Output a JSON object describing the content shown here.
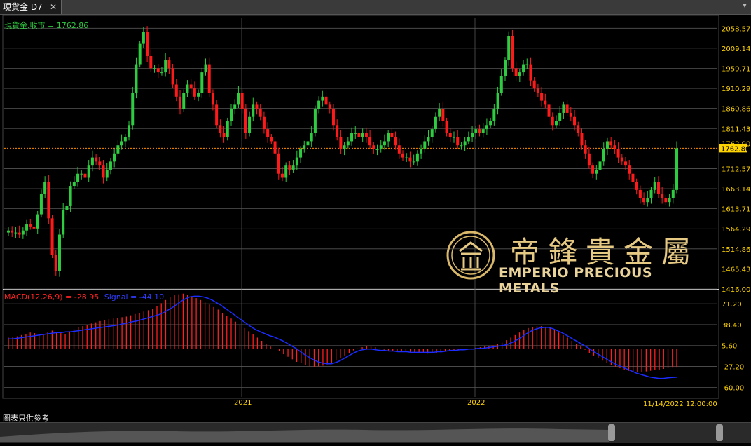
{
  "window": {
    "tab_title": "現貨金 D7",
    "close_glyph": "✕",
    "menu_glyph": "▾"
  },
  "footer": {
    "note": "圖表只供參考"
  },
  "watermark": {
    "cn": "帝鋒貴金屬",
    "en": "EMPERIO PRECIOUS METALS"
  },
  "colors": {
    "up": "#2ecc40",
    "down": "#ff1a1a",
    "grid": "#555555",
    "axis_text": "#ffd400",
    "macd_hist": "#ff2020",
    "signal": "#1a2cff",
    "last_line": "#ff8c00"
  },
  "chart_data": [
    {
      "type": "candlestick",
      "legend": "現貨金.收市 = 1762.86",
      "last_price": 1762.86,
      "last_label": "1762.86",
      "overlay_label": "1762.90",
      "y_ticks": [
        2058.57,
        2009.14,
        1959.71,
        1910.29,
        1860.86,
        1811.43,
        1762.0,
        1712.57,
        1663.14,
        1613.71,
        1564.29,
        1514.86,
        1465.43,
        1416.0
      ],
      "y_tick_labels": [
        "2058.57",
        "2009.14",
        "1959.71",
        "1910.29",
        "1860.86",
        "1811.43",
        "1712.57",
        "1663.14",
        "1613.71",
        "1564.29",
        "1514.86",
        "1465.43",
        "1416.00"
      ],
      "ylim": [
        1416.0,
        2083.29
      ],
      "closes": [
        1560,
        1555,
        1555,
        1550,
        1560,
        1575,
        1570,
        1565,
        1600,
        1650,
        1680,
        1590,
        1500,
        1460,
        1550,
        1610,
        1620,
        1670,
        1680,
        1700,
        1700,
        1690,
        1720,
        1740,
        1730,
        1720,
        1690,
        1710,
        1730,
        1750,
        1770,
        1780,
        1790,
        1820,
        1900,
        1970,
        2020,
        2050,
        1990,
        1960,
        1960,
        1950,
        1950,
        1980,
        1960,
        1920,
        1890,
        1860,
        1900,
        1920,
        1910,
        1890,
        1900,
        1950,
        1970,
        1900,
        1870,
        1820,
        1800,
        1790,
        1830,
        1860,
        1870,
        1900,
        1860,
        1800,
        1840,
        1870,
        1860,
        1840,
        1810,
        1790,
        1780,
        1750,
        1700,
        1690,
        1720,
        1710,
        1720,
        1740,
        1760,
        1770,
        1780,
        1800,
        1860,
        1880,
        1890,
        1870,
        1860,
        1820,
        1790,
        1760,
        1770,
        1780,
        1800,
        1800,
        1790,
        1800,
        1790,
        1770,
        1760,
        1760,
        1770,
        1780,
        1800,
        1790,
        1770,
        1750,
        1740,
        1740,
        1730,
        1730,
        1750,
        1760,
        1780,
        1790,
        1810,
        1840,
        1860,
        1830,
        1800,
        1790,
        1790,
        1770,
        1770,
        1780,
        1790,
        1800,
        1810,
        1800,
        1810,
        1820,
        1830,
        1860,
        1900,
        1940,
        1980,
        2040,
        1960,
        1940,
        1950,
        1970,
        1970,
        1930,
        1910,
        1900,
        1880,
        1870,
        1840,
        1820,
        1830,
        1850,
        1870,
        1850,
        1840,
        1820,
        1800,
        1770,
        1750,
        1720,
        1700,
        1710,
        1730,
        1760,
        1780,
        1770,
        1760,
        1740,
        1730,
        1720,
        1700,
        1680,
        1660,
        1640,
        1630,
        1640,
        1660,
        1680,
        1650,
        1640,
        1630,
        1640,
        1660,
        1762.86
      ],
      "x_tick_labels": [
        "2021",
        "2022",
        "11/14/2022 12:00:00"
      ]
    },
    {
      "type": "bar",
      "legend_macd": "MACD(12,26,9) = -28.95",
      "legend_signal": "Signal = -44.10",
      "y_tick_labels": [
        "71.20",
        "38.40",
        "5.60",
        "-27.20",
        "-60.00"
      ],
      "y_ticks": [
        71.2,
        38.4,
        5.6,
        -27.2,
        -60.0
      ],
      "ylim": [
        -75.0,
        90.0
      ],
      "macd": [
        18,
        19,
        20,
        22,
        24,
        26,
        25,
        24,
        24,
        26,
        29,
        27,
        25,
        24,
        28,
        31,
        34,
        36,
        38,
        40,
        42,
        44,
        46,
        47,
        48,
        49,
        50,
        51,
        53,
        55,
        57,
        59,
        61,
        63,
        67,
        72,
        77,
        82,
        85,
        86,
        87,
        85,
        83,
        80,
        77,
        73,
        70,
        66,
        62,
        57,
        52,
        48,
        43,
        38,
        33,
        28,
        23,
        18,
        13,
        8,
        4,
        1,
        -3,
        -8,
        -12,
        -16,
        -20,
        -22,
        -25,
        -27,
        -28,
        -27,
        -26,
        -24,
        -21,
        -18,
        -14,
        -10,
        -6,
        -2,
        1,
        3,
        5,
        4,
        3,
        1,
        -1,
        -2,
        -3,
        -3,
        -4,
        -4,
        -5,
        -5,
        -6,
        -6,
        -7,
        -6,
        -6,
        -5,
        -4,
        -3,
        -2,
        -1,
        0,
        0,
        1,
        2,
        3,
        4,
        5,
        6,
        8,
        10,
        14,
        18,
        22,
        26,
        30,
        33,
        35,
        36,
        36,
        35,
        33,
        30,
        26,
        22,
        18,
        13,
        8,
        4,
        -1,
        -6,
        -10,
        -14,
        -18,
        -22,
        -25,
        -28,
        -30,
        -32,
        -34,
        -36,
        -36,
        -36,
        -35,
        -34,
        -33,
        -32,
        -31,
        -30,
        -29,
        -28.95
      ],
      "signal": [
        16,
        16,
        17,
        18,
        19,
        20,
        21,
        22,
        23,
        24,
        25,
        26,
        26,
        27,
        27,
        28,
        29,
        30,
        31,
        32,
        33,
        34,
        35,
        36,
        37,
        38,
        40,
        41,
        43,
        44,
        46,
        48,
        50,
        52,
        54,
        57,
        61,
        65,
        70,
        75,
        79,
        82,
        83,
        83,
        82,
        80,
        77,
        73,
        69,
        64,
        59,
        54,
        49,
        44,
        39,
        34,
        30,
        27,
        24,
        21,
        19,
        16,
        13,
        9,
        5,
        1,
        -4,
        -9,
        -13,
        -17,
        -20,
        -22,
        -23,
        -23,
        -21,
        -18,
        -14,
        -10,
        -6,
        -3,
        -1,
        0,
        0,
        -1,
        -2,
        -2,
        -3,
        -3,
        -4,
        -4,
        -4,
        -5,
        -5,
        -5,
        -5,
        -5,
        -5,
        -4,
        -4,
        -3,
        -2,
        -2,
        -1,
        -1,
        0,
        0,
        1,
        1,
        2,
        3,
        4,
        5,
        6,
        8,
        11,
        15,
        19,
        24,
        28,
        31,
        33,
        34,
        34,
        32,
        29,
        26,
        22,
        18,
        14,
        10,
        6,
        2,
        -3,
        -7,
        -11,
        -15,
        -19,
        -23,
        -26,
        -29,
        -32,
        -35,
        -38,
        -40,
        -42,
        -44,
        -45,
        -46,
        -46,
        -45,
        -44.5,
        -44.1
      ]
    }
  ]
}
